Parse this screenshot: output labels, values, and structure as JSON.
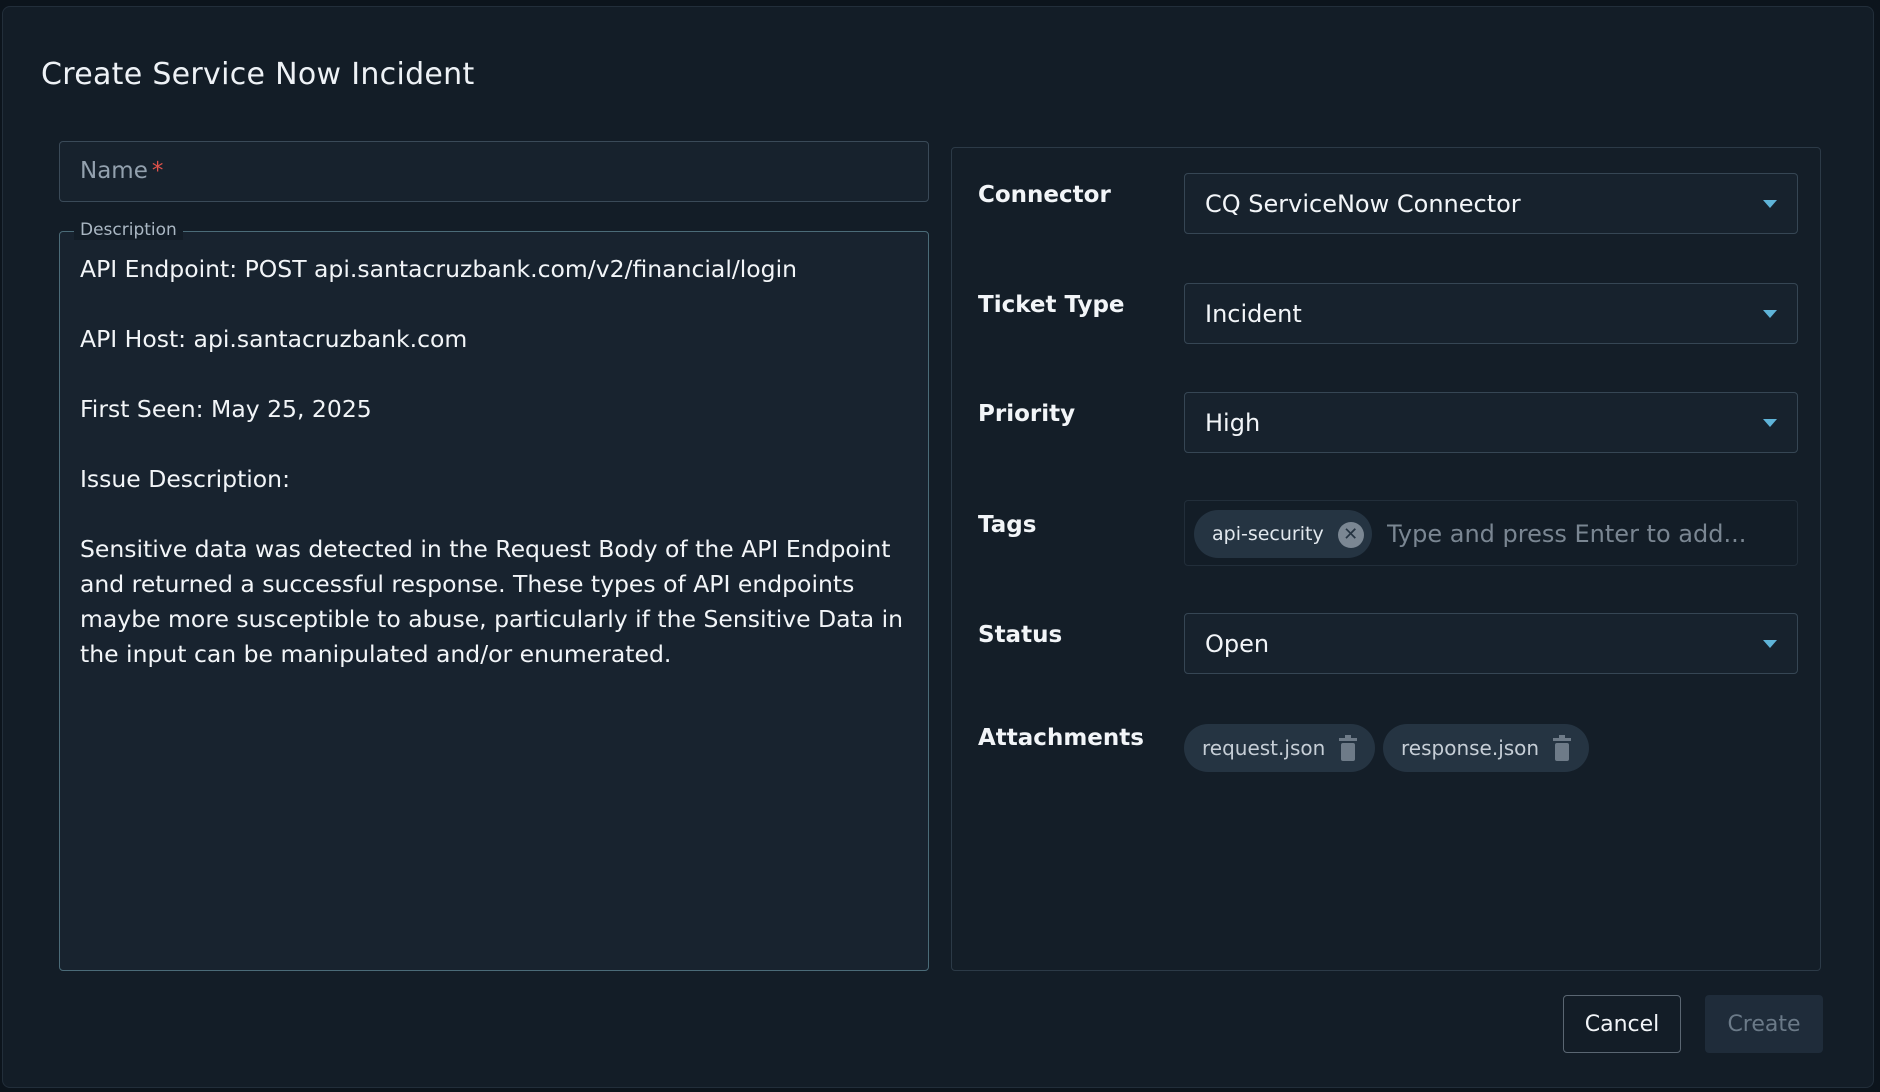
{
  "dialog": {
    "title": "Create Service Now Incident"
  },
  "name_field": {
    "label": "Name",
    "required_mark": "*"
  },
  "description": {
    "legend": "Description",
    "text": "API Endpoint: POST api.santacruzbank.com/v2/financial/login\n\nAPI Host: api.santacruzbank.com\n\nFirst Seen: May 25, 2025\n\nIssue Description:\n\nSensitive data was detected in the Request Body of the API Endpoint and returned a successful response. These types of API endpoints maybe more susceptible to abuse, particularly if the Sensitive Data in the input can be manipulated and/or enumerated."
  },
  "form": {
    "connector": {
      "label": "Connector",
      "value": "CQ ServiceNow Connector"
    },
    "ticket_type": {
      "label": "Ticket Type",
      "value": "Incident"
    },
    "priority": {
      "label": "Priority",
      "value": "High"
    },
    "tags": {
      "label": "Tags",
      "chips": [
        "api-security"
      ],
      "placeholder": "Type and press Enter to add..."
    },
    "status": {
      "label": "Status",
      "value": "Open"
    },
    "attachments": {
      "label": "Attachments",
      "files": [
        "request.json",
        "response.json"
      ]
    }
  },
  "buttons": {
    "cancel": "Cancel",
    "create": "Create"
  },
  "colors": {
    "accent": "#5fb4d8",
    "required": "#e0524a",
    "background": "#131d27"
  },
  "icons": {
    "dropdown": "caret-down-icon",
    "chip_remove": "close-circle-icon",
    "attachment_remove": "trash-icon"
  }
}
